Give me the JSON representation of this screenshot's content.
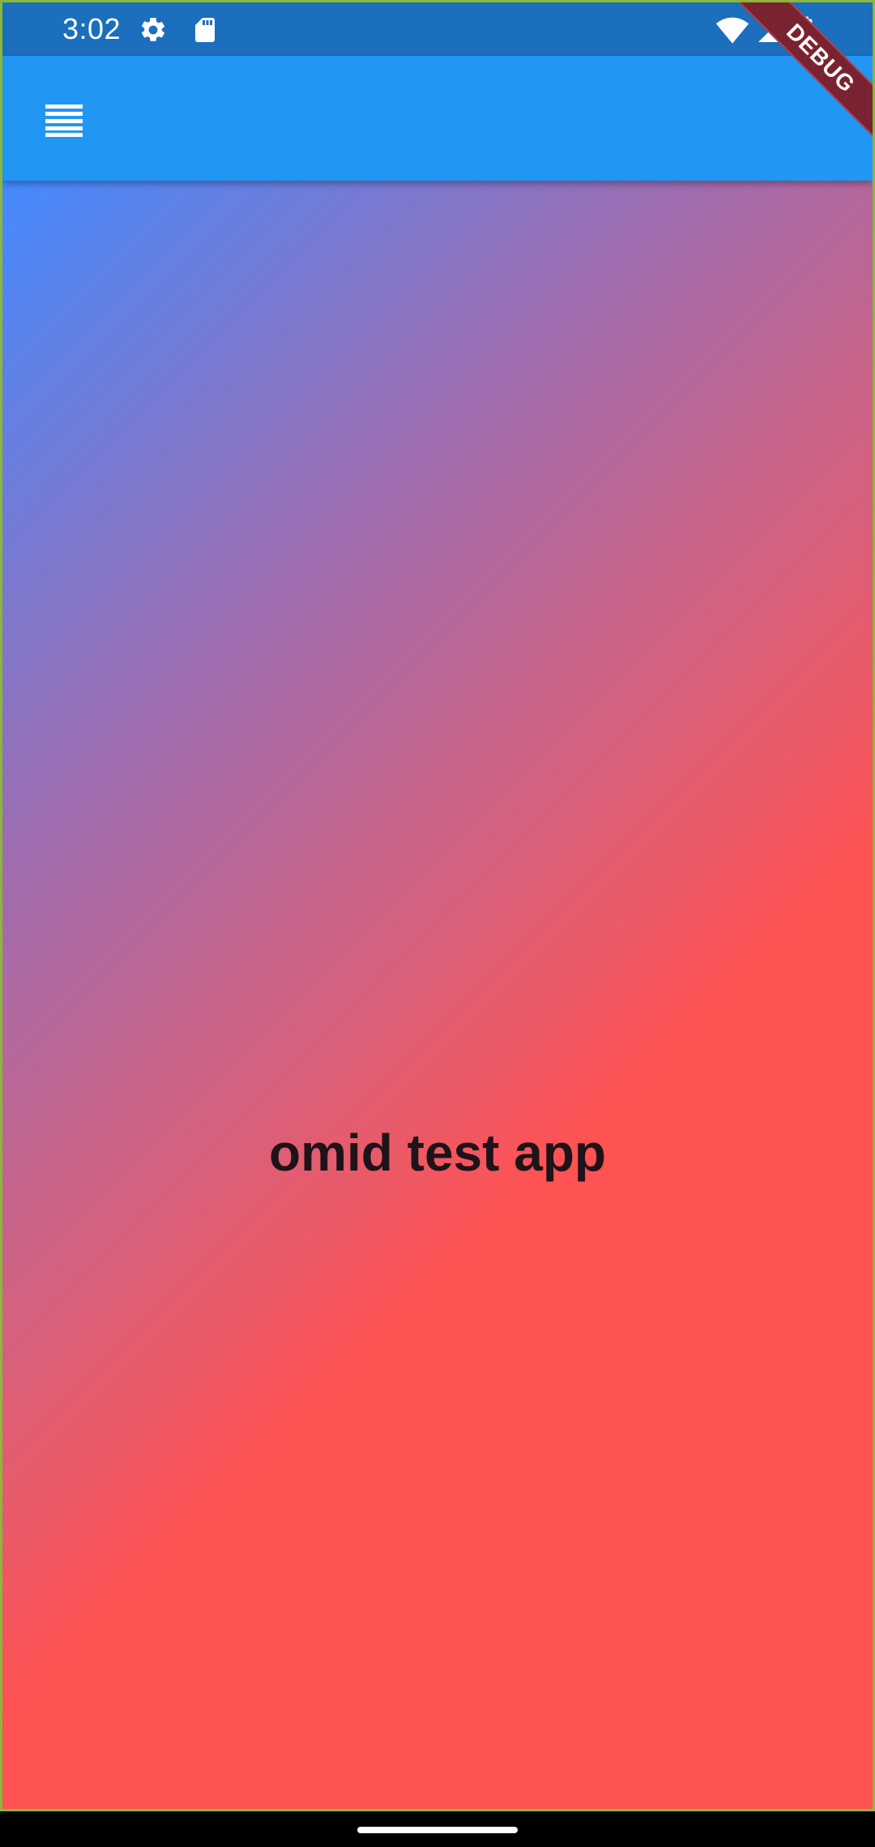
{
  "status_bar": {
    "time": "3:02",
    "background": "#1b6fbc",
    "left_icons": [
      "settings-icon",
      "sd-card-icon"
    ],
    "right_icons": [
      "wifi-icon",
      "cellular-signal-icon",
      "battery-icon"
    ]
  },
  "app_bar": {
    "background": "#2196f3",
    "menu_icon": "menu-icon"
  },
  "main": {
    "title": "omid test app",
    "gradient_start": "#448aff",
    "gradient_end": "#ff5252"
  },
  "debug_banner": {
    "label": "DEBUG"
  }
}
